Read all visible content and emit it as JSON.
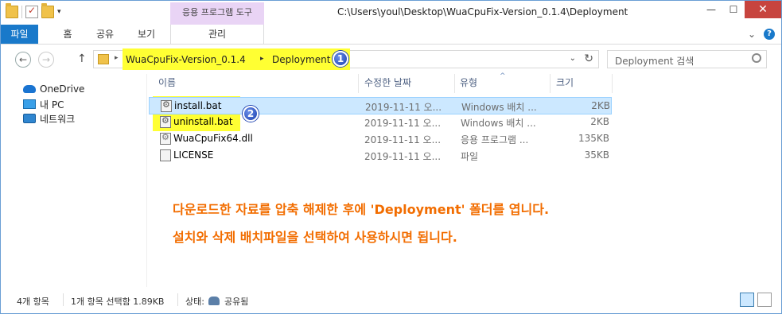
{
  "window": {
    "title": "C:\\Users\\youl\\Desktop\\WuaCpuFix-Version_0.1.4\\Deployment",
    "contextual_tab_group": "응용 프로그램 도구",
    "close_symbol": "✕",
    "minimize_symbol": "—",
    "maximize_symbol": "☐"
  },
  "ribbon": {
    "tabs": [
      "파일",
      "홈",
      "공유",
      "보기"
    ],
    "manage_tab": "관리",
    "help": "?",
    "collapse": "⌄"
  },
  "address": {
    "crumbs": [
      "WuaCpuFix-Version_0.1.4",
      "Deployment"
    ],
    "badge": "1",
    "search_placeholder": "Deployment 검색"
  },
  "nav_pane": {
    "items": [
      {
        "label": "OneDrive",
        "icon": "cloud-icon"
      },
      {
        "label": "내 PC",
        "icon": "pc-icon"
      },
      {
        "label": "네트워크",
        "icon": "network-icon"
      }
    ]
  },
  "file_list": {
    "columns": [
      "이름",
      "수정한 날짜",
      "유형",
      "크기"
    ],
    "rows": [
      {
        "name": "install.bat",
        "date": "2019-11-11 오...",
        "type": "Windows 배치 ...",
        "size": "2KB",
        "icon": "bat-file-icon",
        "selected": true
      },
      {
        "name": "uninstall.bat",
        "date": "2019-11-11 오...",
        "type": "Windows 배치 ...",
        "size": "2KB",
        "icon": "bat-file-icon",
        "selected": false
      },
      {
        "name": "WuaCpuFix64.dll",
        "date": "2019-11-11 오...",
        "type": "응용 프로그램 ...",
        "size": "135KB",
        "icon": "dll-file-icon",
        "selected": false
      },
      {
        "name": "LICENSE",
        "date": "2019-11-11 오...",
        "type": "파일",
        "size": "35KB",
        "icon": "file-icon",
        "selected": false
      }
    ],
    "badge": "2"
  },
  "annotation": {
    "line1": "다운로드한 자료를 압축 해제한 후에 'Deployment' 폴더를 엽니다.",
    "line2": "설치와 삭제 배치파일을 선택하여 사용하시면 됩니다."
  },
  "status": {
    "count": "4개 항목",
    "selection": "1개 항목 선택함 1.89KB",
    "state_label": "상태:",
    "state_value": "공유됨"
  },
  "colors": {
    "file_tab": "#1979ca",
    "contextual_tab": "#e9d4f5",
    "highlight": "#ffff33",
    "annotation": "#f26d00",
    "selection": "#cce8ff",
    "close_button": "#c7443e"
  }
}
